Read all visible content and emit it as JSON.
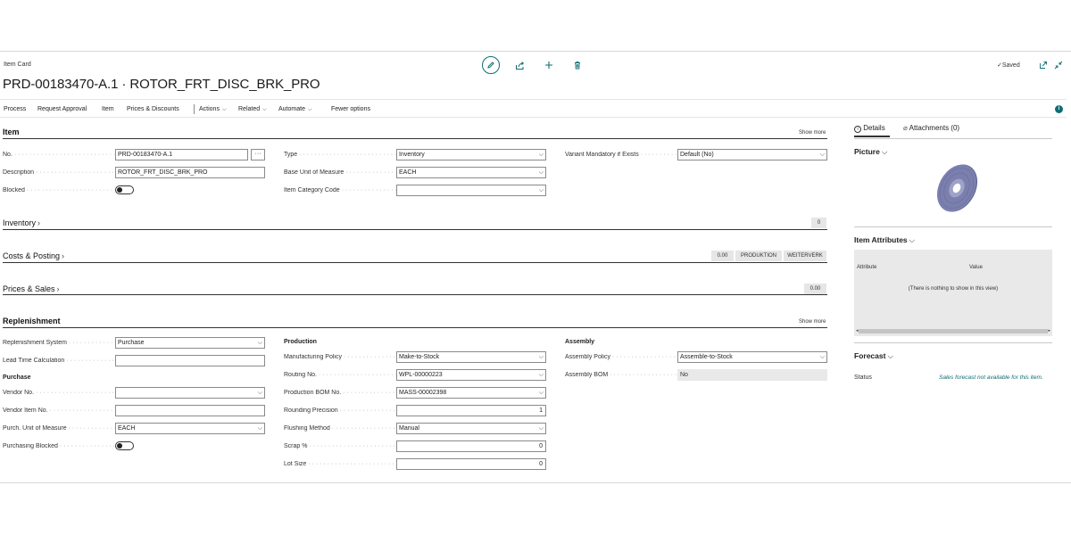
{
  "header": {
    "breadcrumb": "Item Card",
    "title": "PRD-00183470-A.1 · ROTOR_FRT_DISC_BRK_PRO",
    "saved_label": "Saved"
  },
  "menu": {
    "items": [
      "Process",
      "Request Approval",
      "Item",
      "Prices & Discounts",
      "Actions",
      "Related",
      "Automate",
      "Fewer options"
    ]
  },
  "item_section": {
    "title": "Item",
    "show_more": "Show more",
    "no_label": "No.",
    "no_value": "PRD-00183470-A.1",
    "ellipsis": "···",
    "description_label": "Description",
    "description_value": "ROTOR_FRT_DISC_BRK_PRO",
    "blocked_label": "Blocked",
    "type_label": "Type",
    "type_value": "Inventory",
    "base_uom_label": "Base Unit of Measure",
    "base_uom_value": "EACH",
    "category_label": "Item Category Code",
    "category_value": "",
    "variant_label": "Variant Mandatory if Exists",
    "variant_value": "Default (No)"
  },
  "inventory_section": {
    "title": "Inventory",
    "badge": "0"
  },
  "costs_section": {
    "title": "Costs & Posting",
    "badges": [
      "0.00",
      "PRODUKTION",
      "WEITERVERK"
    ]
  },
  "prices_section": {
    "title": "Prices & Sales",
    "badge": "0.00"
  },
  "replenishment_section": {
    "title": "Replenishment",
    "show_more": "Show more",
    "system_label": "Replenishment System",
    "system_value": "Purchase",
    "lead_time_label": "Lead Time Calculation",
    "lead_time_value": "",
    "purchase_heading": "Purchase",
    "vendor_no_label": "Vendor No.",
    "vendor_no_value": "",
    "vendor_item_label": "Vendor Item No.",
    "vendor_item_value": "",
    "purch_uom_label": "Purch. Unit of Measure",
    "purch_uom_value": "EACH",
    "purch_blocked_label": "Purchasing Blocked",
    "production_heading": "Production",
    "mfg_policy_label": "Manufacturing Policy",
    "mfg_policy_value": "Make-to-Stock",
    "routing_label": "Routing No.",
    "routing_value": "WPL-00000223",
    "bom_label": "Production BOM No.",
    "bom_value": "MASS-00002398",
    "rounding_label": "Rounding Precision",
    "rounding_value": "1",
    "flushing_label": "Flushing Method",
    "flushing_value": "Manual",
    "scrap_label": "Scrap %",
    "scrap_value": "0",
    "lot_label": "Lot Size",
    "lot_value": "0",
    "assembly_heading": "Assembly",
    "asm_policy_label": "Assembly Policy",
    "asm_policy_value": "Assemble-to-Stock",
    "asm_bom_label": "Assembly BOM",
    "asm_bom_value": "No"
  },
  "factbox": {
    "tab_details": "Details",
    "tab_attachments": "Attachments (0)",
    "picture_title": "Picture",
    "attributes_title": "Item Attributes",
    "attr_col_attribute": "Attribute",
    "attr_col_value": "Value",
    "attr_empty": "(There is nothing to show in this view)",
    "forecast_title": "Forecast",
    "status_label": "Status",
    "status_value": "Sales forecast not available for this item."
  },
  "colors": {
    "accent": "#0e6e74",
    "rotor": "#6a6f9e"
  }
}
